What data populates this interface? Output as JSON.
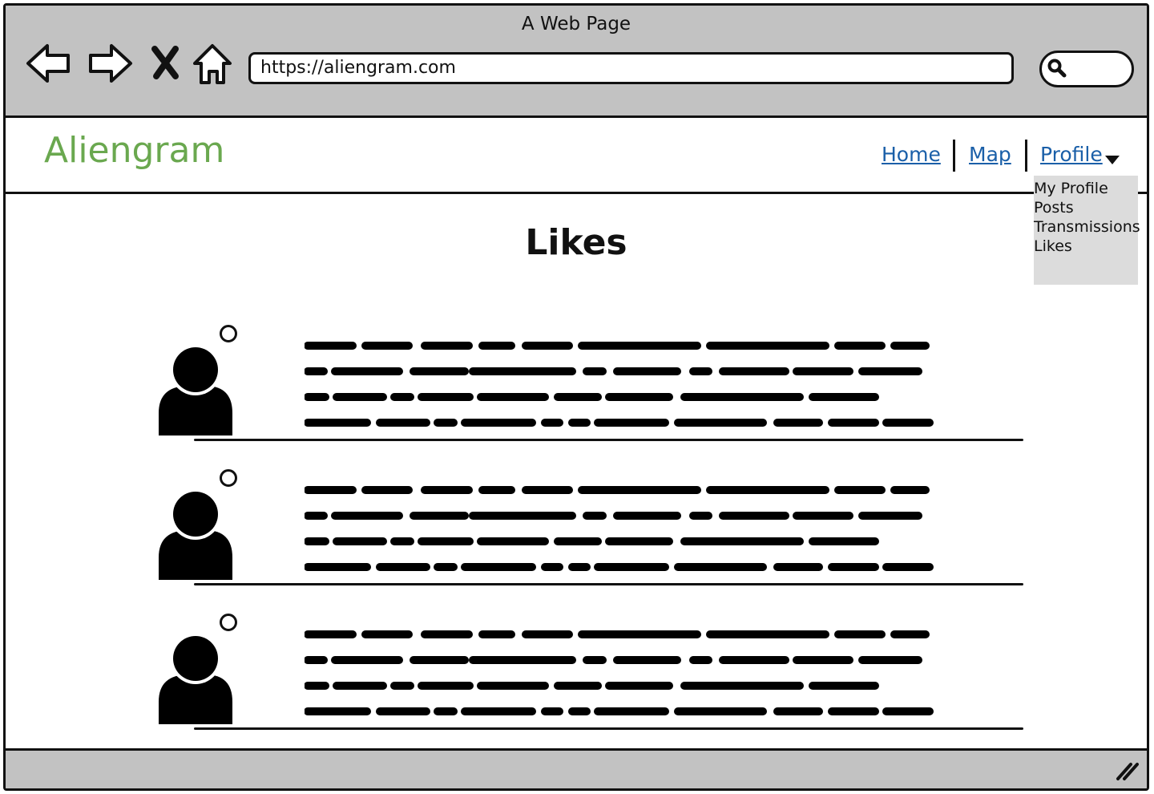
{
  "browser": {
    "title": "A Web Page",
    "url": "https://aliengram.com",
    "icons": [
      "back-arrow-icon",
      "forward-arrow-icon",
      "close-x-icon",
      "home-icon",
      "search-icon"
    ]
  },
  "site": {
    "brand": "Aliengram",
    "brand_color": "#6aa84f",
    "nav": {
      "home": "Home",
      "map": "Map",
      "profile": "Profile"
    },
    "dropdown": [
      "My Profile",
      "Posts",
      "Transmissions",
      "Likes"
    ]
  },
  "main": {
    "title": "Likes",
    "feed_count_note": ""
  },
  "colors": {
    "chrome": "#c2c2c2",
    "link": "#1a5fa8",
    "dropdown_bg": "#dcdcdc"
  }
}
